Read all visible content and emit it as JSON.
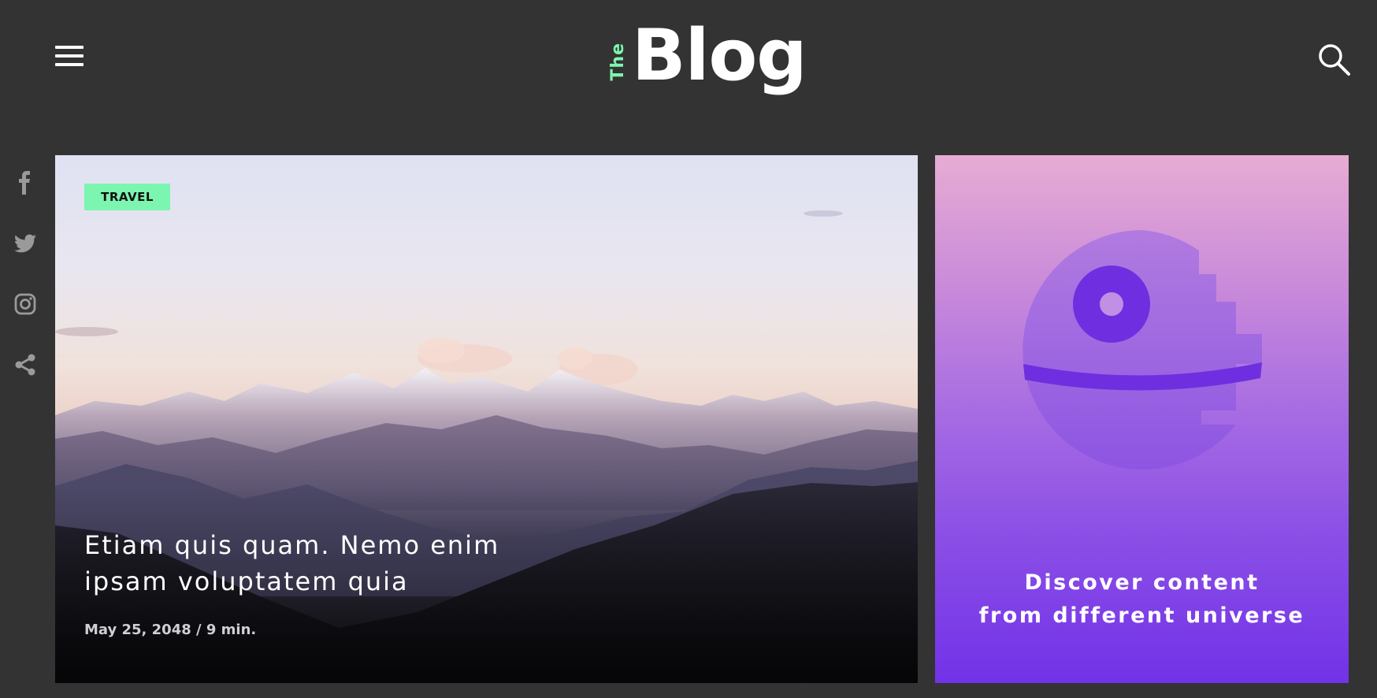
{
  "header": {
    "logo_prefix": "The",
    "logo_main": "Blog",
    "menu_icon": "hamburger-menu-icon",
    "search_icon": "search-icon"
  },
  "social": [
    {
      "name": "facebook-icon"
    },
    {
      "name": "twitter-icon"
    },
    {
      "name": "instagram-icon"
    },
    {
      "name": "share-icon"
    }
  ],
  "hero": {
    "tag": "TRAVEL",
    "title": "Etiam quis quam. Nemo enim ipsam voluptatem quia",
    "meta": "May 25, 2048 / 9 min."
  },
  "promo": {
    "line1": "Discover content",
    "line2": "from different universe",
    "icon": "death-star-icon"
  },
  "colors": {
    "background": "#333333",
    "accent": "#7cf5b0",
    "promo_top": "#e7acd3",
    "promo_bottom": "#7232e8"
  }
}
